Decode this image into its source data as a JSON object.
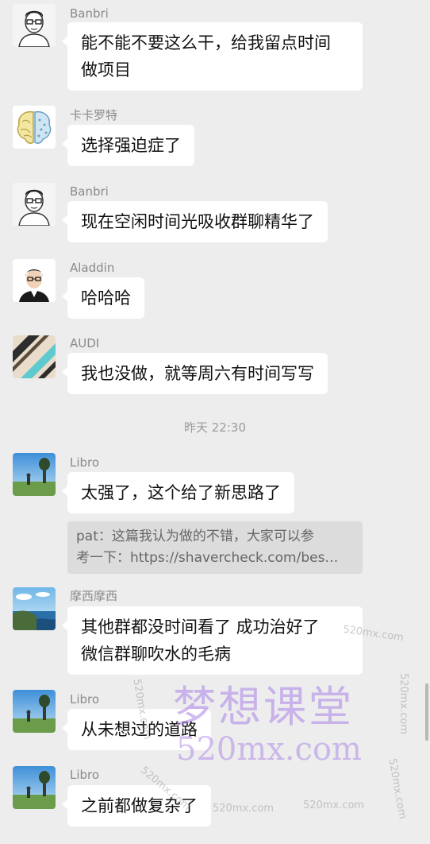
{
  "messages": [
    {
      "sender": "Banbri",
      "lines": [
        "能不能不要这么干，给我留点时间",
        "做项目"
      ],
      "avatar_icon": "man-glasses-avatar-icon"
    },
    {
      "sender": "卡卡罗特",
      "lines": [
        "选择强迫症了"
      ],
      "avatar_icon": "brain-avatar-icon"
    },
    {
      "sender": "Banbri",
      "lines": [
        "现在空闲时间光吸收群聊精华了"
      ],
      "avatar_icon": "man-glasses-avatar-icon"
    },
    {
      "sender": "Aladdin",
      "lines": [
        "哈哈哈"
      ],
      "avatar_icon": "man-portrait-avatar-icon"
    },
    {
      "sender": "AUDI",
      "lines": [
        "我也没做，就等周六有时间写写"
      ],
      "avatar_icon": "stripes-avatar-icon"
    },
    {
      "sender": "Libro",
      "lines": [
        "太强了，这个给了新思路了"
      ],
      "avatar_icon": "landscape-tree-avatar-icon"
    },
    {
      "sender": "摩西摩西",
      "lines": [
        "其他群都没时间看了 成功治好了",
        "微信群聊吹水的毛病"
      ],
      "avatar_icon": "coast-avatar-icon"
    },
    {
      "sender": "Libro",
      "lines": [
        "从未想过的道路"
      ],
      "avatar_icon": "landscape-tree-avatar-icon"
    },
    {
      "sender": "Libro",
      "lines": [
        "之前都做复杂了"
      ],
      "avatar_icon": "landscape-tree-avatar-icon"
    }
  ],
  "timestamp": "昨天 22:30",
  "quote": {
    "line1": "pat：这篇我认为做的不错，大家可以参",
    "line2": "考一下：https://shavercheck.com/bes…"
  },
  "watermark": {
    "main": "梦想课堂",
    "sub": "520mx.com",
    "small": "520mx.com"
  },
  "colors": {
    "background": "#ededed",
    "bubble": "#ffffff",
    "quote_bg": "#dcdcdc",
    "sender_text": "#8a8a8a"
  }
}
